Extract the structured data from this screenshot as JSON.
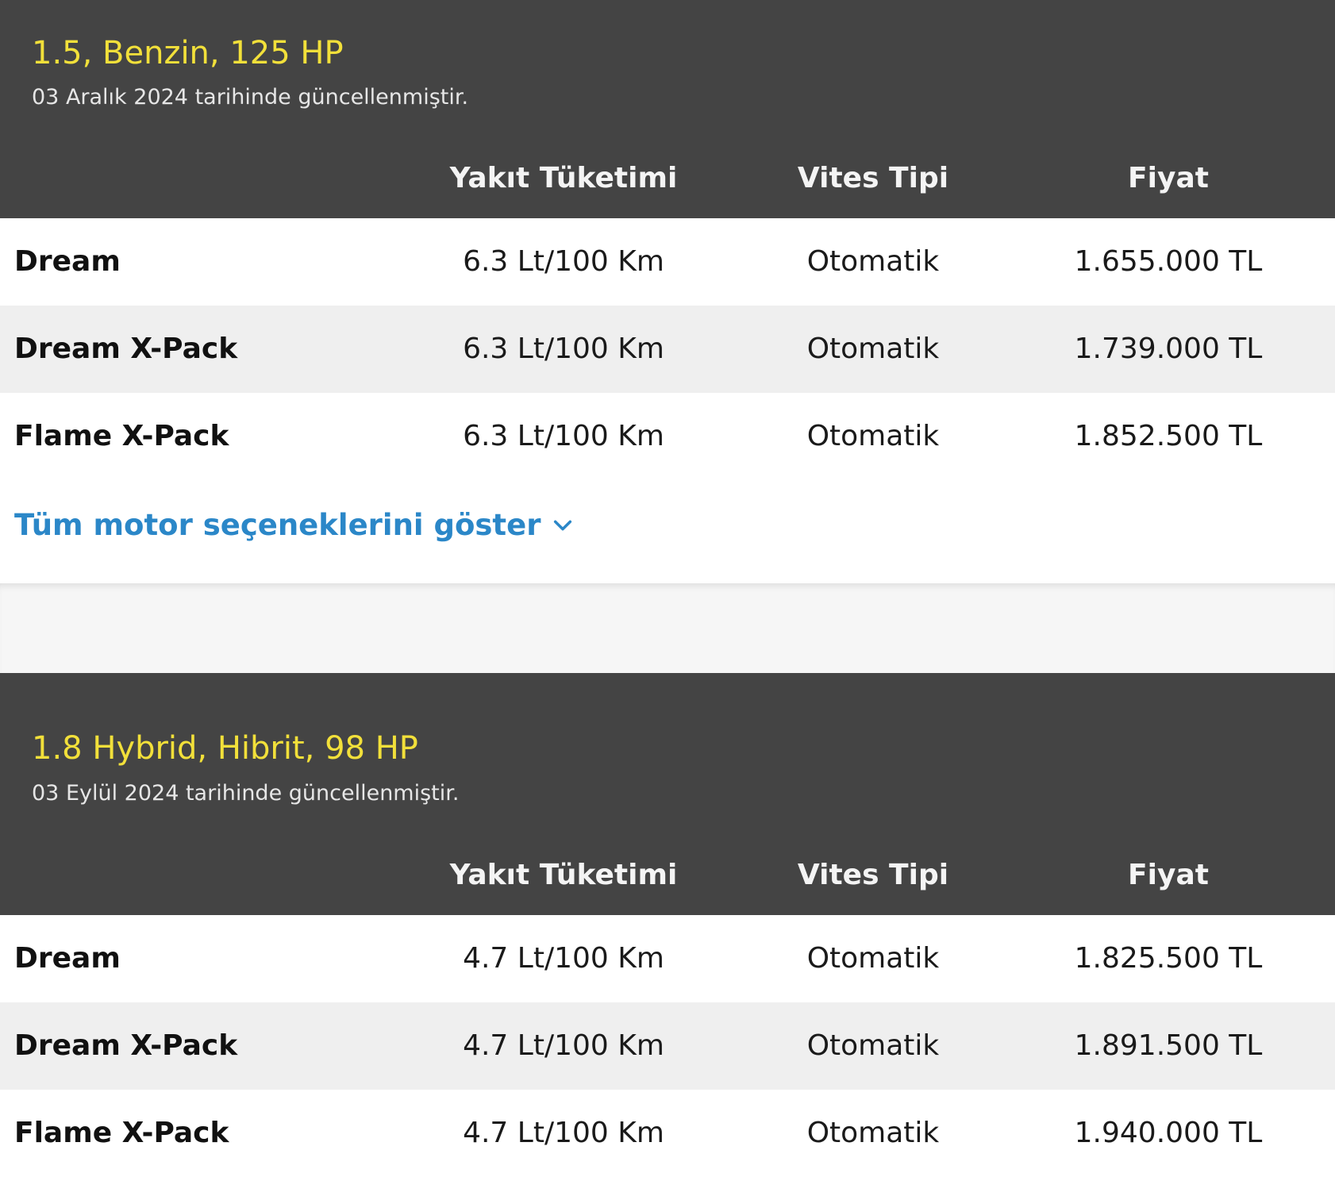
{
  "sections": [
    {
      "engine_title": "1.5, Benzin, 125 HP",
      "updated_text": "03 Aralık 2024 tarihinde güncellenmiştir.",
      "columns": {
        "fuel": "Yakıt Tüketimi",
        "gear": "Vites Tipi",
        "price": "Fiyat"
      },
      "rows": [
        {
          "trim": "Dream",
          "fuel": "6.3 Lt/100 Km",
          "gear": "Otomatik",
          "price": "1.655.000 TL"
        },
        {
          "trim": "Dream X-Pack",
          "fuel": "6.3 Lt/100 Km",
          "gear": "Otomatik",
          "price": "1.739.000 TL"
        },
        {
          "trim": "Flame X-Pack",
          "fuel": "6.3 Lt/100 Km",
          "gear": "Otomatik",
          "price": "1.852.500 TL"
        }
      ],
      "show_all_label": "Tüm motor seçeneklerini göster"
    },
    {
      "engine_title": "1.8 Hybrid, Hibrit, 98 HP",
      "updated_text": "03 Eylül 2024 tarihinde güncellenmiştir.",
      "columns": {
        "fuel": "Yakıt Tüketimi",
        "gear": "Vites Tipi",
        "price": "Fiyat"
      },
      "rows": [
        {
          "trim": "Dream",
          "fuel": "4.7 Lt/100 Km",
          "gear": "Otomatik",
          "price": "1.825.500 TL"
        },
        {
          "trim": "Dream X-Pack",
          "fuel": "4.7 Lt/100 Km",
          "gear": "Otomatik",
          "price": "1.891.500 TL"
        },
        {
          "trim": "Flame X-Pack",
          "fuel": "4.7 Lt/100 Km",
          "gear": "Otomatik",
          "price": "1.940.000 TL"
        }
      ]
    }
  ],
  "icons": {
    "show_all": "chevron-down-icon"
  },
  "colors": {
    "header_bg": "#444444",
    "title_yellow": "#f2e03a",
    "link_blue": "#2b87c8",
    "alt_row_bg": "#efefef"
  }
}
